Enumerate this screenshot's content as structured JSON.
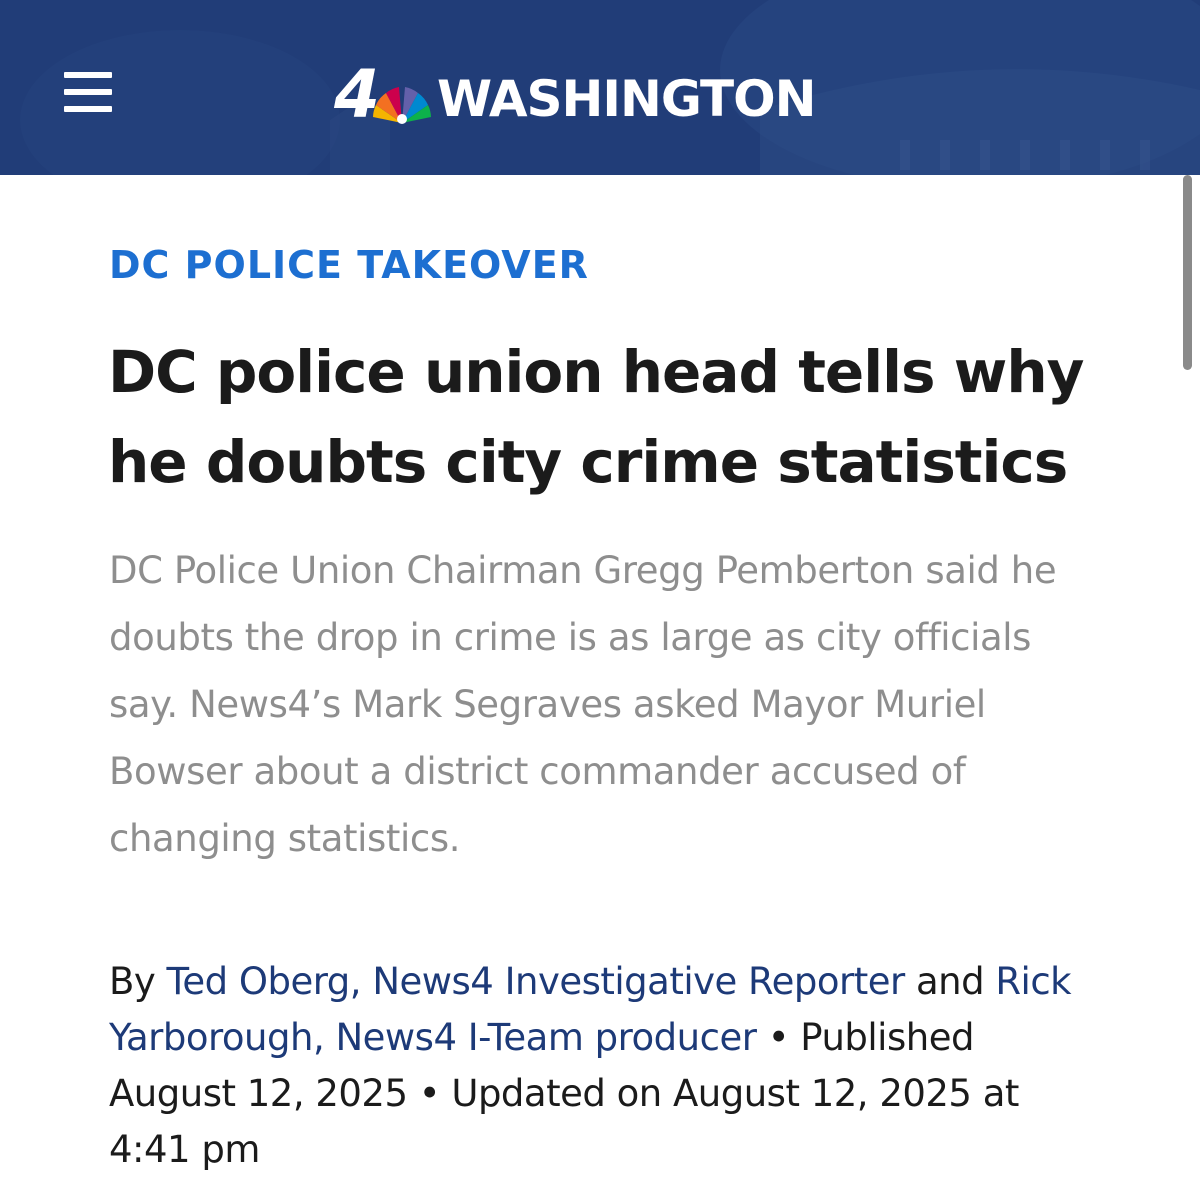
{
  "header": {
    "logo_number": "4",
    "logo_city": "WASHINGTON",
    "menu_icon": "hamburger-menu-icon",
    "background_color": "#24427f"
  },
  "article": {
    "category": "DC POLICE TAKEOVER",
    "headline": "DC police union head tells why he doubts city crime statistics",
    "summary": "DC Police Union Chairman Gregg Pemberton said he doubts the drop in crime is as large as city officials say. News4’s Mark Segraves asked Mayor Muriel Bowser about a district commander accused of changing statistics.",
    "byline": {
      "by": "By",
      "author1": "Ted Oberg, News4 Investigative Reporter",
      "and": "and",
      "author2": "Rick Yarborough, News4 I-Team producer",
      "published_label": "• Published",
      "published_date": "August 12, 2025",
      "updated_label": "• Updated on",
      "updated_date": "August 12, 2025 at 4:41 pm"
    }
  },
  "colors": {
    "category": "#1d6fd1",
    "author_link": "#1d3a78",
    "summary_text": "#8e8e8e",
    "headline_text": "#1b1b1b"
  }
}
